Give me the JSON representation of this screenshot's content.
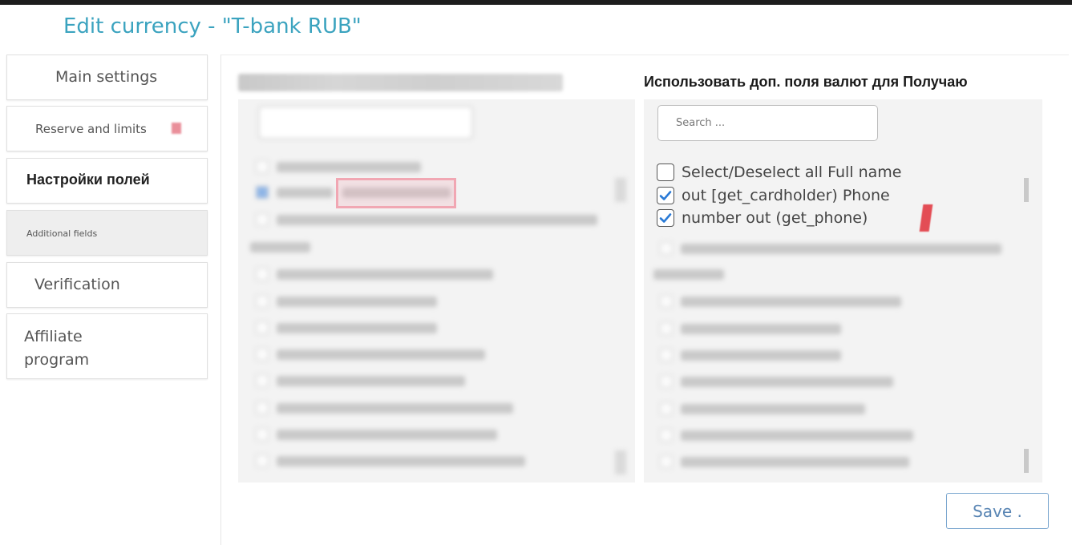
{
  "page_title": "Edit currency - \"T-bank RUB\"",
  "tabs": [
    {
      "label": "Main settings"
    },
    {
      "label": "Reserve and limits"
    },
    {
      "label": "Настройки полей"
    },
    {
      "label": "Additional fields"
    },
    {
      "label": "Verification"
    },
    {
      "label": "Affiliate program"
    }
  ],
  "right_panel": {
    "title": "Использовать доп. поля валют для Получаю",
    "search_placeholder": "Search ...",
    "options": [
      {
        "label": "Select/Deselect all Full name",
        "checked": false
      },
      {
        "label": "out [get_cardholder) Phone",
        "checked": true
      },
      {
        "label": "number out (get_phone)",
        "checked": true
      }
    ]
  },
  "save_label": "Save .",
  "colors": {
    "title": "#3ba3bf",
    "checkbox": "#2a7ad6",
    "save_border": "#7aa6cf",
    "red_mark": "#e1313a"
  }
}
